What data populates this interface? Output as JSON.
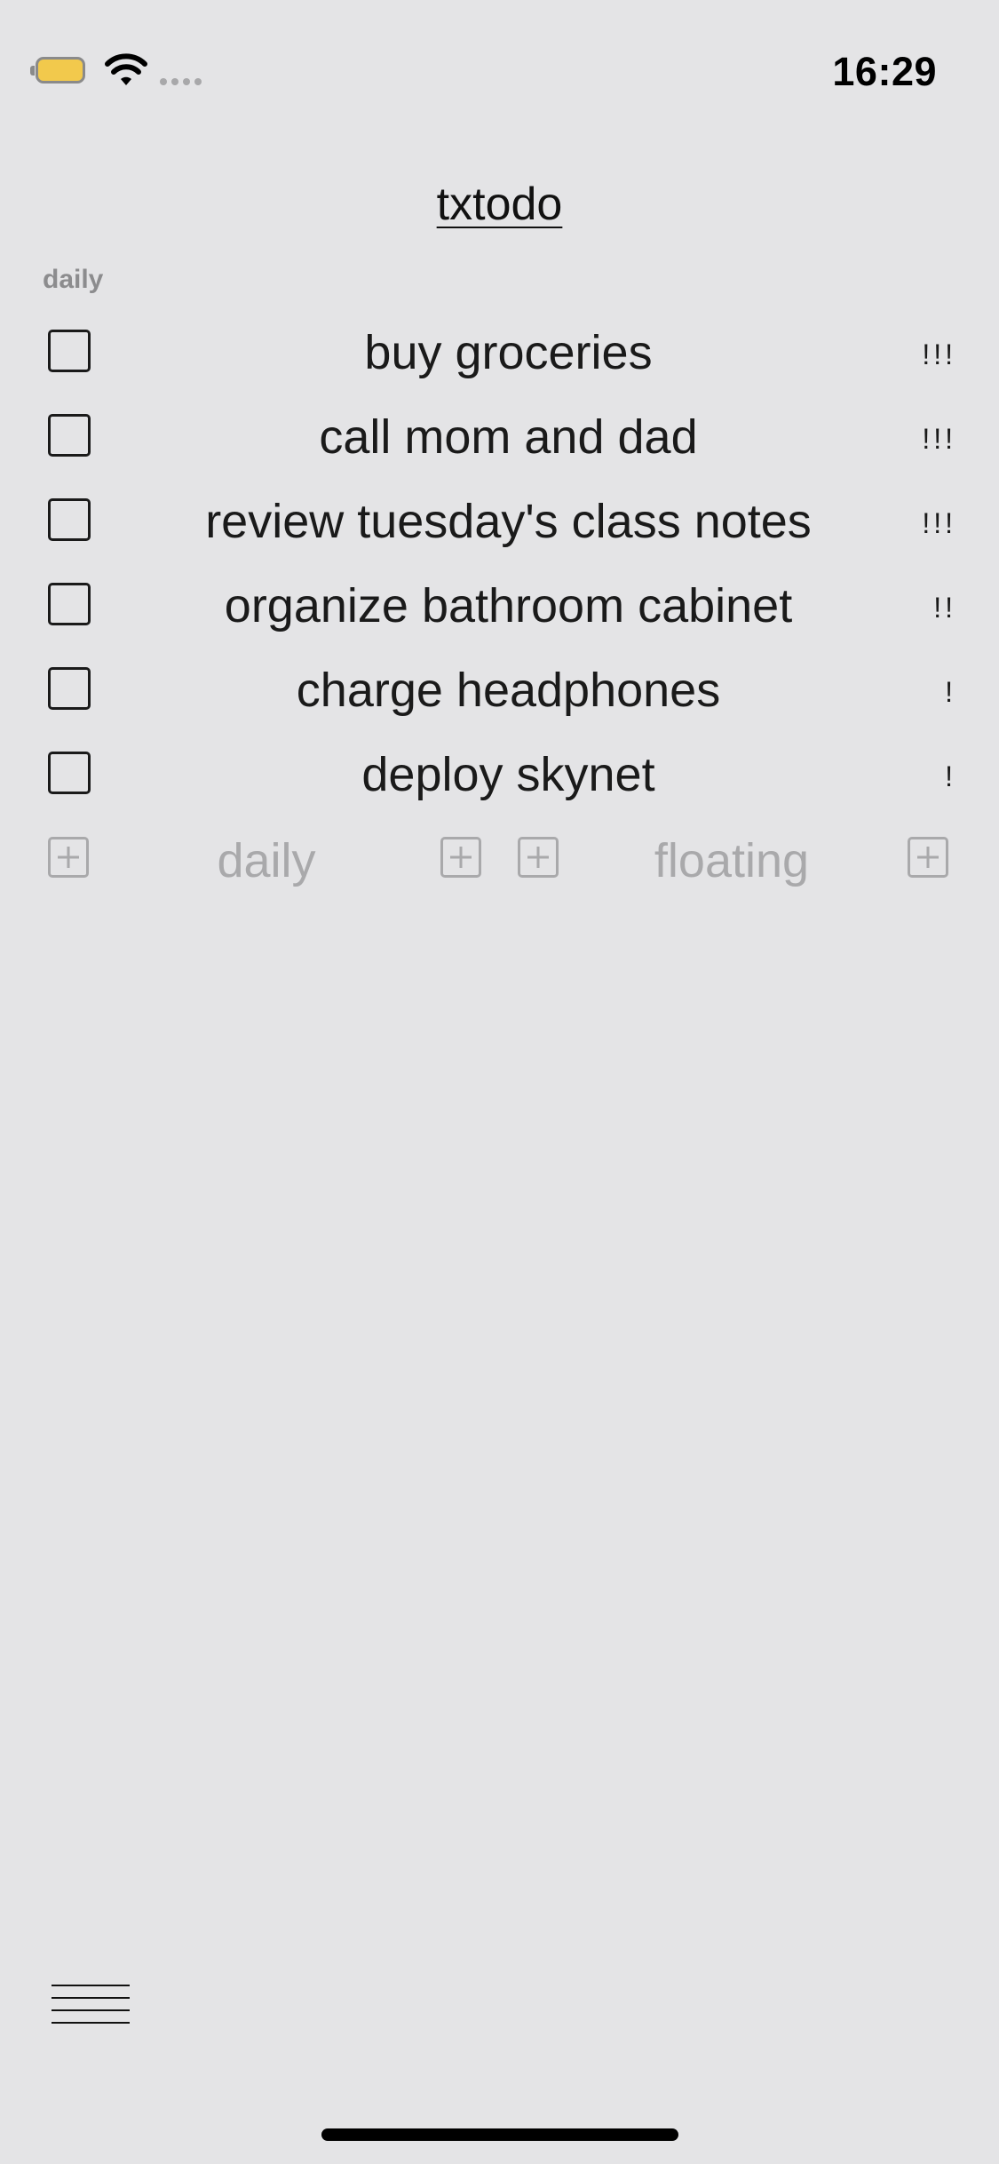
{
  "status_bar": {
    "time": "16:29",
    "battery_color": "#f2c94c"
  },
  "app": {
    "title": "txtodo"
  },
  "section": {
    "label": "daily"
  },
  "tasks": [
    {
      "text": "buy groceries",
      "priority": "!!!"
    },
    {
      "text": "call mom and dad",
      "priority": "!!!"
    },
    {
      "text": "review tuesday's class notes",
      "priority": "!!!"
    },
    {
      "text": "organize bathroom cabinet",
      "priority": "!!"
    },
    {
      "text": "charge headphones",
      "priority": "!"
    },
    {
      "text": "deploy skynet",
      "priority": "!"
    }
  ],
  "add_row": {
    "daily_label": "daily",
    "floating_label": "floating"
  },
  "icons": {
    "menu": "hamburger-menu-icon",
    "add": "plus-square-icon",
    "wifi": "wifi-icon",
    "battery": "battery-icon"
  }
}
